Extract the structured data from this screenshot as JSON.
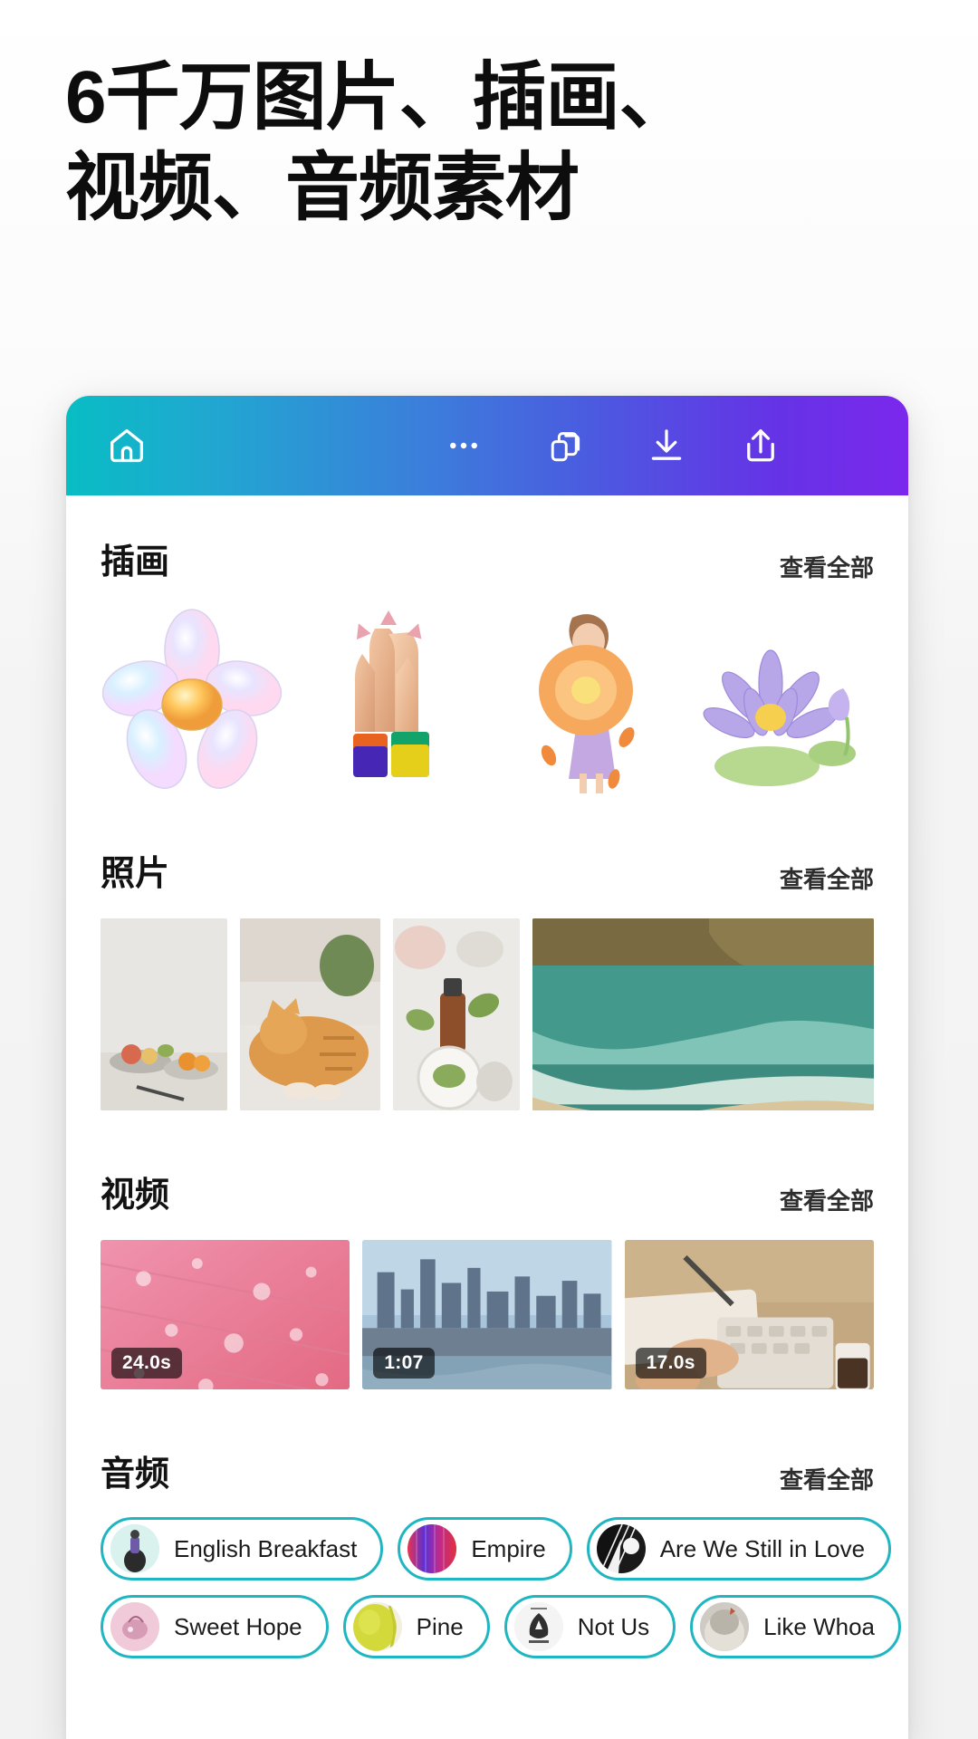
{
  "headline": "6千万图片、插画、\n视频、音频素材",
  "toolbar": {
    "home_icon": "home-icon",
    "more_icon": "more-dots-icon",
    "copy_icon": "duplicate-icon",
    "download_icon": "download-icon",
    "share_icon": "share-icon",
    "gradient_start": "#08bdc4",
    "gradient_end": "#7b28ec"
  },
  "see_all_label": "查看全部",
  "sections": {
    "illustrations": {
      "title": "插画",
      "see_all": "查看全部",
      "items": [
        {
          "name": "holographic-flower"
        },
        {
          "name": "praying-hands"
        },
        {
          "name": "flower-girl"
        },
        {
          "name": "purple-water-lily"
        }
      ]
    },
    "photos": {
      "title": "照片",
      "see_all": "查看全部",
      "items": [
        {
          "name": "fruit-bowls-still-life"
        },
        {
          "name": "orange-cat-on-bed"
        },
        {
          "name": "skincare-serum-flatlay"
        },
        {
          "name": "ocean-shore-cliff"
        }
      ]
    },
    "videos": {
      "title": "视频",
      "see_all": "查看全部",
      "items": [
        {
          "name": "pink-leaf-water-drops",
          "duration": "24.0s"
        },
        {
          "name": "city-skyline-river",
          "duration": "1:07"
        },
        {
          "name": "hands-typing-keyboard",
          "duration": "17.0s"
        }
      ]
    },
    "audio": {
      "title": "音频",
      "see_all": "查看全部",
      "rows": [
        [
          {
            "label": "English Breakfast",
            "thumb": "english-breakfast-cover"
          },
          {
            "label": "Empire",
            "thumb": "empire-cover"
          },
          {
            "label": "Are We Still in Love",
            "thumb": "are-we-still-in-love-cover"
          }
        ],
        [
          {
            "label": "Sweet Hope",
            "thumb": "sweet-hope-cover"
          },
          {
            "label": "Pine",
            "thumb": "pine-cover"
          },
          {
            "label": "Not Us",
            "thumb": "not-us-cover"
          },
          {
            "label": "Like Whoa",
            "thumb": "like-whoa-cover"
          }
        ]
      ]
    }
  },
  "colors": {
    "chip_border": "#1fb6c1",
    "headline_text": "#0d0d0d",
    "page_bg": "#f2f2f2"
  }
}
